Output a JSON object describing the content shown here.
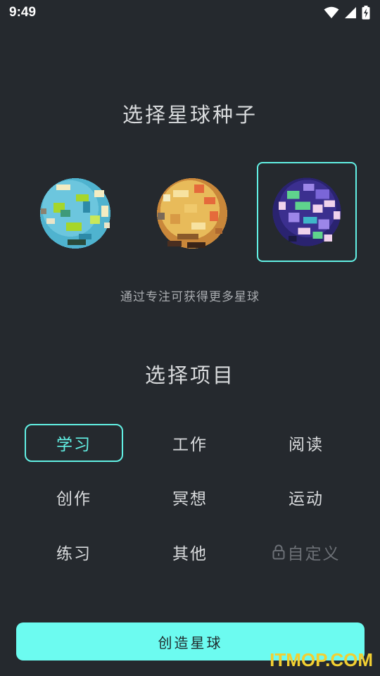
{
  "status": {
    "time": "9:49"
  },
  "seed_section": {
    "title": "选择星球种子",
    "hint": "通过专注可获得更多星球",
    "planets": [
      {
        "name": "ocean-planet",
        "selected": false,
        "colors": [
          "#6cc6de",
          "#2d8aa8",
          "#a6d62a",
          "#f3ecc2"
        ]
      },
      {
        "name": "desert-planet",
        "selected": false,
        "colors": [
          "#e8bb5a",
          "#c9873a",
          "#e56a3b",
          "#f7e2a0"
        ]
      },
      {
        "name": "nebula-planet",
        "selected": true,
        "colors": [
          "#3b2f8f",
          "#5fd38d",
          "#9c86e8",
          "#f0d2ec"
        ]
      }
    ]
  },
  "project_section": {
    "title": "选择项目",
    "options": [
      {
        "label": "学习",
        "selected": true,
        "locked": false
      },
      {
        "label": "工作",
        "selected": false,
        "locked": false
      },
      {
        "label": "阅读",
        "selected": false,
        "locked": false
      },
      {
        "label": "创作",
        "selected": false,
        "locked": false
      },
      {
        "label": "冥想",
        "selected": false,
        "locked": false
      },
      {
        "label": "运动",
        "selected": false,
        "locked": false
      },
      {
        "label": "练习",
        "selected": false,
        "locked": false
      },
      {
        "label": "其他",
        "selected": false,
        "locked": false
      },
      {
        "label": "自定义",
        "selected": false,
        "locked": true,
        "icon": "lock-icon"
      }
    ]
  },
  "create_button": {
    "label": "创造星球"
  },
  "watermark": {
    "text": "ITMOP.COM"
  },
  "colors": {
    "accent": "#62f0e4",
    "button": "#6cfbf0",
    "background": "#25292e"
  }
}
